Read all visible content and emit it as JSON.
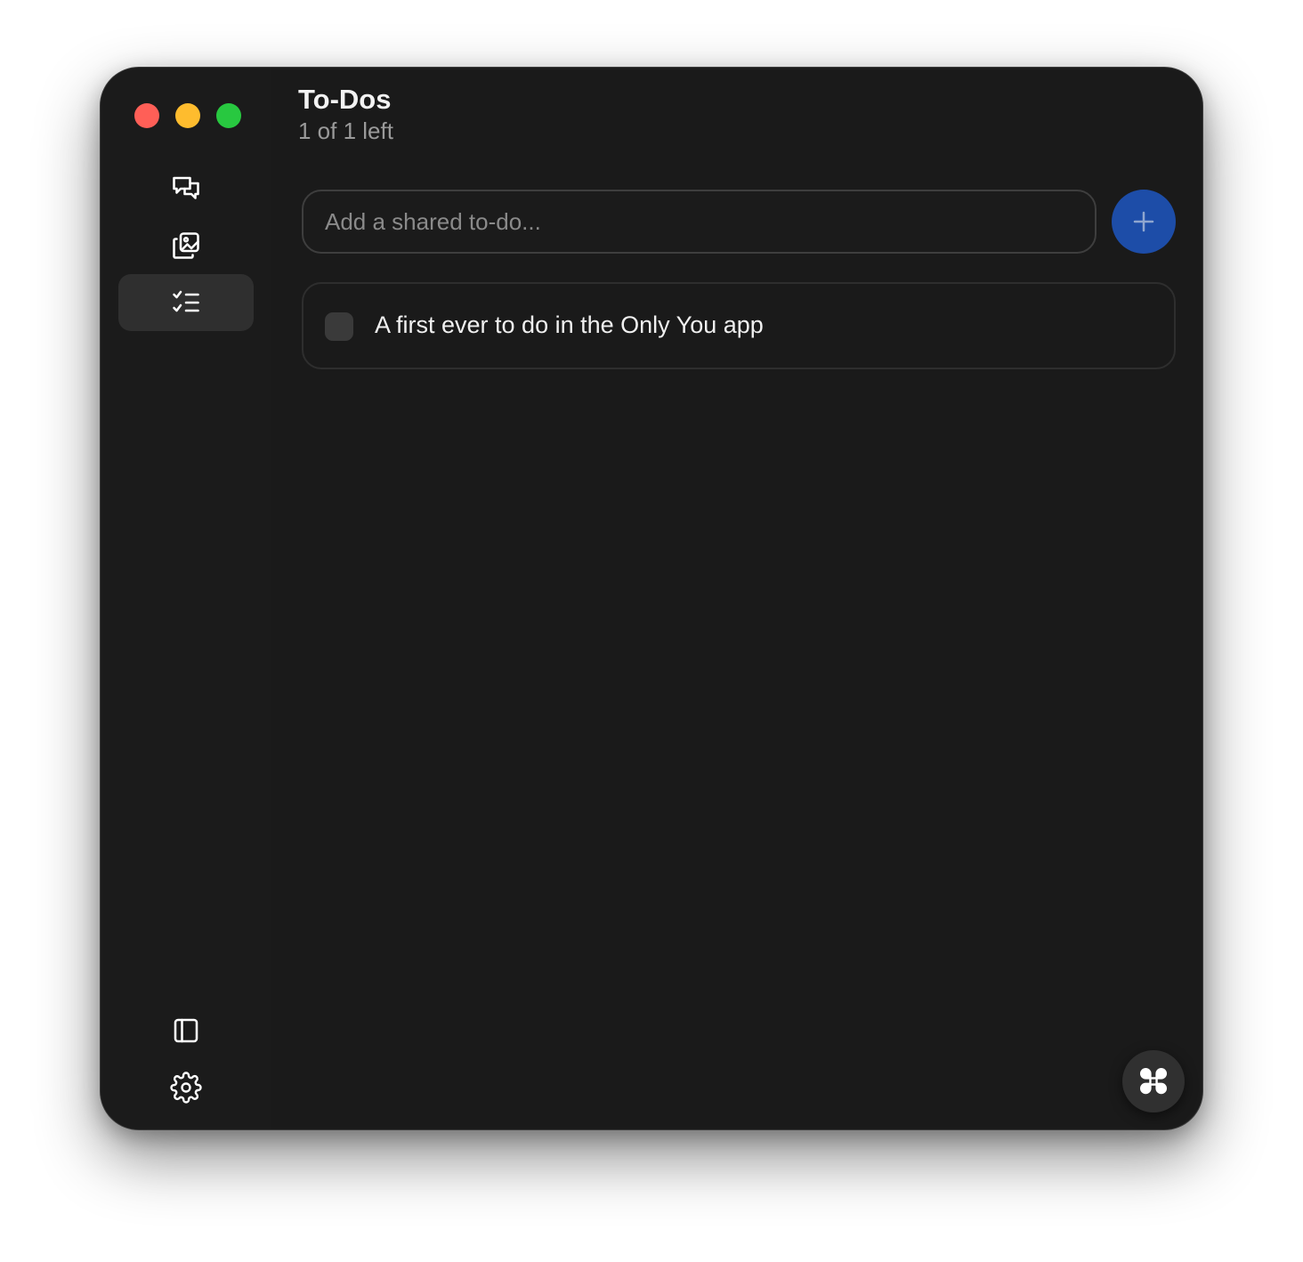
{
  "window": {
    "controls": [
      "close",
      "minimize",
      "zoom"
    ]
  },
  "sidebar": {
    "items": [
      {
        "name": "chat",
        "icon": "chat-bubbles-icon",
        "active": false
      },
      {
        "name": "photos",
        "icon": "photo-gallery-icon",
        "active": false
      },
      {
        "name": "todos",
        "icon": "checklist-icon",
        "active": true
      }
    ],
    "bottom_items": [
      {
        "name": "toggle-sidebar",
        "icon": "sidebar-panel-icon"
      },
      {
        "name": "settings",
        "icon": "gear-icon"
      }
    ]
  },
  "header": {
    "title": "To-Dos",
    "subtitle": "1 of 1 left"
  },
  "composer": {
    "placeholder": "Add a shared to-do...",
    "value": "",
    "add_icon": "plus-icon"
  },
  "todos": [
    {
      "text": "A first ever to do in the Only You app",
      "done": false
    }
  ],
  "fab": {
    "icon": "command-key-icon"
  },
  "colors": {
    "background": "#1a1a1a",
    "accent": "#1d4da8",
    "active_nav": "#2f2f2f",
    "text_primary": "#f2f2f2",
    "text_secondary": "#9a9a9a"
  }
}
